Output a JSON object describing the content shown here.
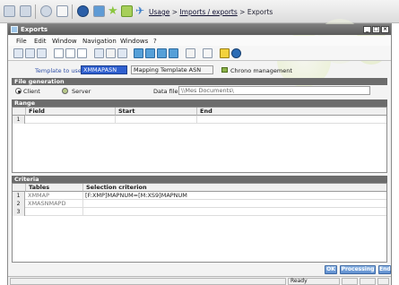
{
  "breadcrumb": {
    "usage": "Usage",
    "sep1": ">",
    "imports_exports": "Imports / exports",
    "sep2": ">",
    "current": "Exports"
  },
  "window": {
    "title": "Exports",
    "btn_min": "_",
    "btn_max": "□",
    "btn_close": "×"
  },
  "menu": [
    "File",
    "Edit",
    "Window",
    "Navigation",
    "Windows",
    "?"
  ],
  "form": {
    "template_label": "Template to use",
    "template_value": "XMMAPASN",
    "template_desc": "Mapping Template ASN",
    "chrono_label": "Chrono management"
  },
  "file_generation": {
    "title": "File generation",
    "client": "Client",
    "server": "Server",
    "selected": "Client",
    "datafile_label": "Data file",
    "datafile_value": "\\\\Mes Documents\\"
  },
  "range": {
    "title": "Range",
    "columns": [
      "Field",
      "Start",
      "End"
    ],
    "rows": [
      {
        "num": "1",
        "field": "",
        "start": "",
        "end": ""
      }
    ]
  },
  "criteria": {
    "title": "Criteria",
    "columns": [
      "Tables",
      "Selection criterion"
    ],
    "rows": [
      {
        "num": "1",
        "table": "XMMAP",
        "criterion": "[F:XMP]MAPNUM=[M:XS9]MAPNUM"
      },
      {
        "num": "2",
        "table": "XMASNMAPD",
        "criterion": ""
      },
      {
        "num": "3",
        "table": "",
        "criterion": ""
      }
    ]
  },
  "buttons": {
    "ok": "OK",
    "processing": "Processing",
    "end": "End"
  },
  "status": {
    "text": "Ready"
  },
  "colors": {
    "accent_blue": "#5f8fcf",
    "section_bar": "#6c6c6c",
    "highlight": "#2f5fcf"
  },
  "icons": [
    "home-icon",
    "back-icon",
    "print-icon",
    "help-icon",
    "cut-icon",
    "copy-icon",
    "refresh-icon",
    "star-icon"
  ]
}
